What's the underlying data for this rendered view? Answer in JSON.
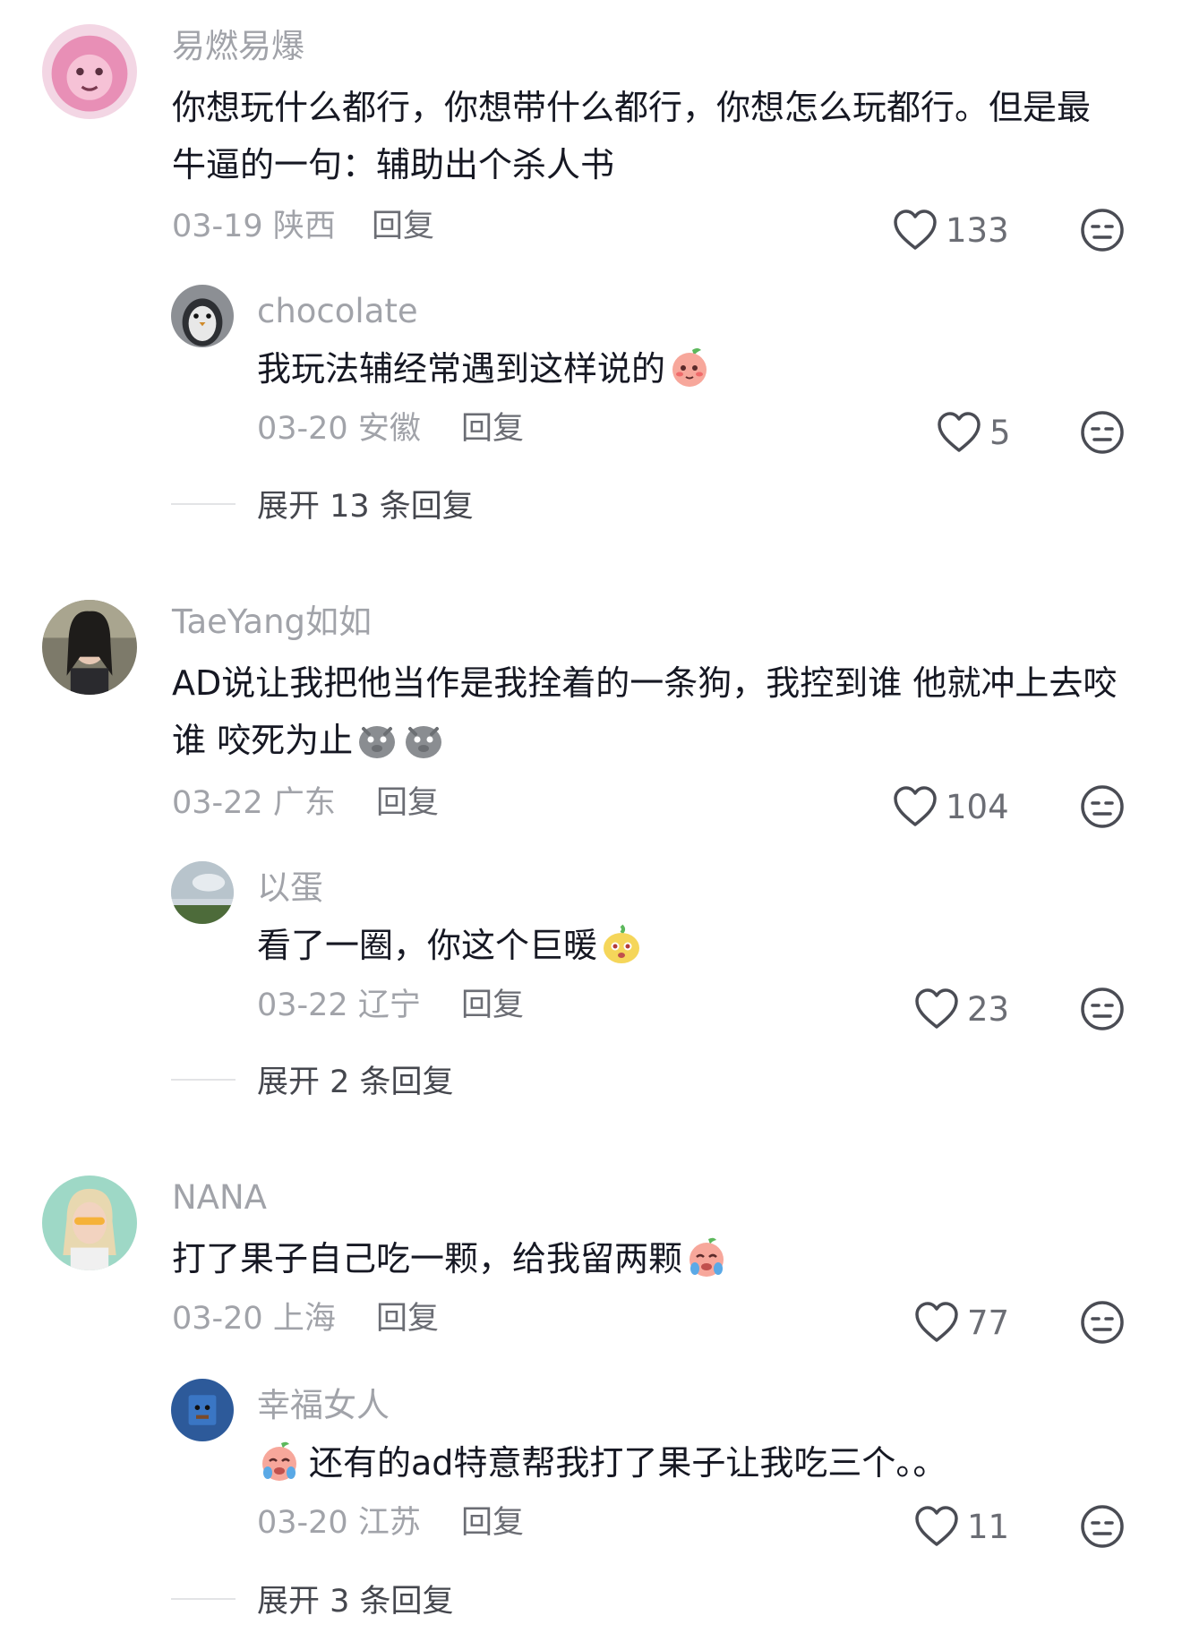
{
  "comments": [
    {
      "username": "易燃易爆",
      "text": "你想玩什么都行，你想带什么都行，你想怎么玩都行。但是最牛逼的一句：辅助出个杀人书",
      "date": "03-19",
      "location": "陕西",
      "reply_label": "回复",
      "likes": "133",
      "reply": {
        "username": "chocolate",
        "text": "我玩法辅经常遇到这样说的",
        "emoji": "peach-shy-emoji",
        "date": "03-20",
        "location": "安徽",
        "reply_label": "回复",
        "likes": "5"
      },
      "expand": "展开 13 条回复"
    },
    {
      "username": "TaeYang如如",
      "text": "AD说让我把他当作是我拴着的一条狗，我控到谁 他就冲上去咬谁 咬死为止",
      "emoji": "grey-pig-emoji",
      "date": "03-22",
      "location": "广东",
      "reply_label": "回复",
      "likes": "104",
      "reply": {
        "username": "以蛋",
        "text": "看了一圈，你这个巨暖",
        "emoji": "yellow-face-emoji",
        "date": "03-22",
        "location": "辽宁",
        "reply_label": "回复",
        "likes": "23"
      },
      "expand": "展开 2 条回复"
    },
    {
      "username": "NANA",
      "text": "打了果子自己吃一颗，给我留两颗",
      "emoji": "crying-peach-emoji",
      "date": "03-20",
      "location": "上海",
      "reply_label": "回复",
      "likes": "77",
      "reply": {
        "username": "幸福女人",
        "text": "还有的ad特意帮我打了果子让我吃三个。。",
        "emoji": "crying-peach-emoji",
        "date": "03-20",
        "location": "江苏",
        "reply_label": "回复",
        "likes": "11"
      },
      "expand": "展开 3 条回复"
    }
  ]
}
